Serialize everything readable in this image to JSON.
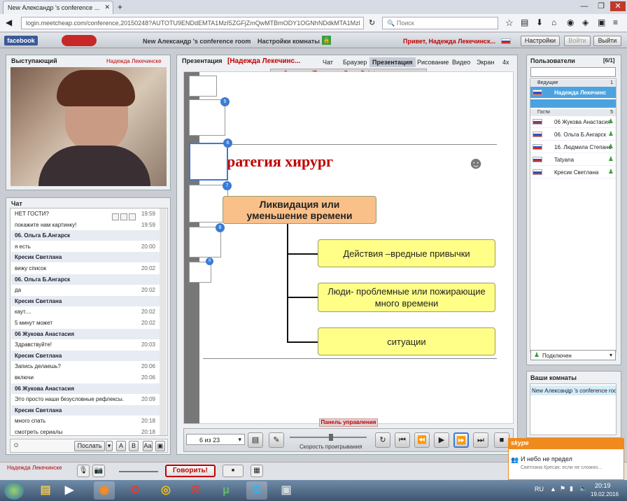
{
  "browser": {
    "tab_title": "New Александр 's conference ...",
    "new_tab": "+",
    "url": "login.meetcheap.com/conference,20150248?AUTOTU9ENDdEMTA1MzI5ZGFjZmQwMTBmODY1OGNhNDdkMTA1Mzl",
    "search_placeholder": "Поиск",
    "win_min": "—",
    "win_max": "❐",
    "win_close": "✕"
  },
  "appbar": {
    "facebook": "facebook",
    "room_title": "New Александр 's conference room",
    "room_settings": "Настройки комнаты",
    "greeting": "Привет, Надежда Лекечинск...",
    "settings_btn": "Настройки",
    "login_btn": "Войти",
    "exit_btn": "Выйти"
  },
  "speaker": {
    "title": "Выступающий",
    "name": "Надежда Лекечинске"
  },
  "chat": {
    "title": "Чат",
    "rows": [
      {
        "user": false,
        "text": "НЕТ ГОСТИ?",
        "time": "19:59"
      },
      {
        "user": false,
        "text": "покажите нам картинку!",
        "time": "19:59"
      },
      {
        "user": true,
        "text": "06. Ольга Б.Ангарск",
        "time": ""
      },
      {
        "user": false,
        "text": "я есть",
        "time": "20:00"
      },
      {
        "user": true,
        "text": "Кресик Светлана",
        "time": ""
      },
      {
        "user": false,
        "text": "вижу список",
        "time": "20:02"
      },
      {
        "user": true,
        "text": "06. Ольга Б.Ангарск",
        "time": ""
      },
      {
        "user": false,
        "text": "да",
        "time": "20:02"
      },
      {
        "user": true,
        "text": "Кресик Светлана",
        "time": ""
      },
      {
        "user": false,
        "text": "каут....",
        "time": "20:02"
      },
      {
        "user": false,
        "text": "5 минут может",
        "time": "20:02"
      },
      {
        "user": true,
        "text": "06 Жукова Анастасия",
        "time": ""
      },
      {
        "user": false,
        "text": "Здравствуйте!",
        "time": "20:03"
      },
      {
        "user": true,
        "text": "Кресик Светлана",
        "time": ""
      },
      {
        "user": false,
        "text": "Запись делаешь?",
        "time": "20:06"
      },
      {
        "user": false,
        "text": "включи",
        "time": "20:06"
      },
      {
        "user": true,
        "text": "06 Жукова Анастасия",
        "time": ""
      },
      {
        "user": false,
        "text": "Это просто наши безусловные рефлексы.",
        "time": "20:09"
      },
      {
        "user": true,
        "text": "Кресик Светлана",
        "time": ""
      },
      {
        "user": false,
        "text": "много спать",
        "time": "20:18"
      },
      {
        "user": false,
        "text": "смотреть сериалы",
        "time": "20:18"
      }
    ],
    "send_btn": "Послать"
  },
  "presentation": {
    "title": "Презентация",
    "presenter": "[Надежда Лекечинс...",
    "tabs": [
      "Чат",
      "Браузер",
      "Презентация",
      "Рисование",
      "Видео",
      "Экран",
      "4x"
    ],
    "upload_bar": "Загрузить/Проиграть PowerPoint презентацию",
    "slide_title": "ратегия хирург",
    "main_box": "Ликвидация или уменьшение времени",
    "branches": [
      "Действия –вредные привычки",
      "Люди- проблемные или пожирающие много времени",
      "ситуации"
    ],
    "thumb_numbers": [
      "5",
      "6",
      "7",
      "8",
      "9"
    ],
    "page_indicator": "6 из 23",
    "speed_label": "Скорость проигрывания",
    "control_panel": "Панель управления"
  },
  "users": {
    "title": "Пользователи",
    "count": "[6/1]",
    "hosts_group": "Ведущие",
    "hosts_count": "1",
    "guests_group": "Гости",
    "guests_count": "5",
    "host": "Надежда Лекечинс",
    "guests": [
      "06 Жукова Анастасия",
      "06. Ольга Б.Ангарск",
      "16. Людмила Степано",
      "Tatyana",
      "Кресик Светлана"
    ],
    "status": "Подключен"
  },
  "rooms": {
    "title": "Ваши комнаты",
    "item": "New Александр 's conference room"
  },
  "bottombar": {
    "user": "Надежда Лекечинске",
    "speak_btn": "Говорить!"
  },
  "skype": {
    "logo": "skype",
    "title": "И небо не предел",
    "message": "Светлана Кресик: если не сложно..."
  },
  "taskbar": {
    "lang": "RU",
    "time": "20:19",
    "date": "19.02.2016"
  },
  "colors": {
    "accent_blue": "#1e5aa8",
    "box_yellow": "#ffff88",
    "box_orange": "#f9c08a",
    "title_red": "#c00000"
  }
}
